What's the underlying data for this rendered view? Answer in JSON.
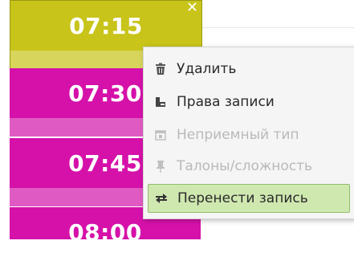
{
  "schedule": {
    "slots": [
      {
        "time": "07:15",
        "close_label": "✕"
      },
      {
        "time": "07:30"
      },
      {
        "time": "07:45"
      },
      {
        "time": "08:00"
      }
    ]
  },
  "context_menu": {
    "items": [
      {
        "label": "Удалить",
        "icon": "trash-icon",
        "disabled": false
      },
      {
        "label": "Права записи",
        "icon": "permission-icon",
        "disabled": false
      },
      {
        "label": "Неприемный тип",
        "icon": "calendar-icon",
        "disabled": true
      },
      {
        "label": "Талоны/сложность",
        "icon": "pin-icon",
        "disabled": true
      },
      {
        "label": "Перенести запись",
        "icon": "move-icon",
        "disabled": false,
        "highlighted": true
      }
    ]
  },
  "colors": {
    "selected_slot": "#c8c41a",
    "pink_slot": "#d511a9",
    "menu_highlight": "#cfe8b0"
  }
}
